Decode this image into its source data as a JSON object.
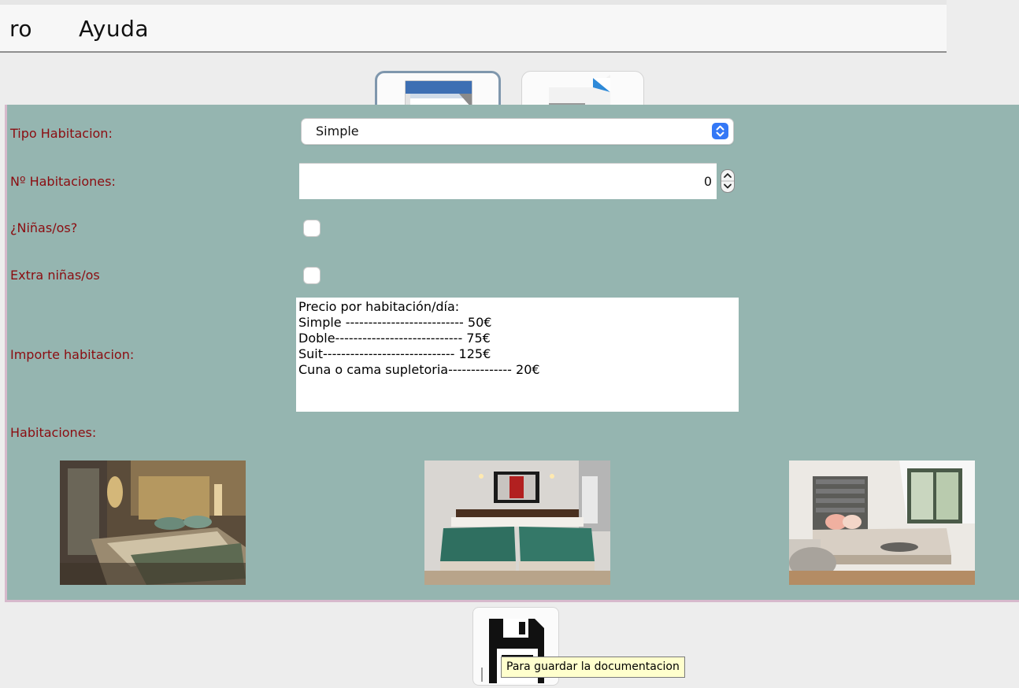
{
  "menu": {
    "items": [
      {
        "label": "ro"
      },
      {
        "label": "Ayuda"
      }
    ]
  },
  "toolbar": {
    "buttons": [
      {
        "icon": "new-document-icon"
      },
      {
        "icon": "document-icon"
      }
    ]
  },
  "form": {
    "tipo_habitacion": {
      "label": "Tipo Habitacion:",
      "value": "Simple",
      "icon": "select-arrows-icon",
      "accent": "#3478f6"
    },
    "num_habitaciones": {
      "label": "Nº Habitaciones:",
      "value": "0",
      "icon": "spinner-arrows-icon"
    },
    "ninos": {
      "label": "¿Niñas/os?"
    },
    "extra_ninos": {
      "label": "Extra niñas/os"
    },
    "importe": {
      "label": "Importe habitacion:",
      "lines": [
        "Precio por habitación/día:",
        "Simple -------------------------- 50€",
        "Doble---------------------------- 75€",
        "Suit----------------------------- 125€",
        "Cuna o cama supletoria-------------- 20€"
      ]
    },
    "habitaciones": {
      "label": "Habitaciones:"
    }
  },
  "footer": {
    "save_icon": "save-floppy-icon",
    "tooltip": "Para guardar la documentacion"
  },
  "colors": {
    "panel_bg": "#95b5b0",
    "label_text": "#8b0c10",
    "tooltip_bg": "#ffffcd"
  }
}
